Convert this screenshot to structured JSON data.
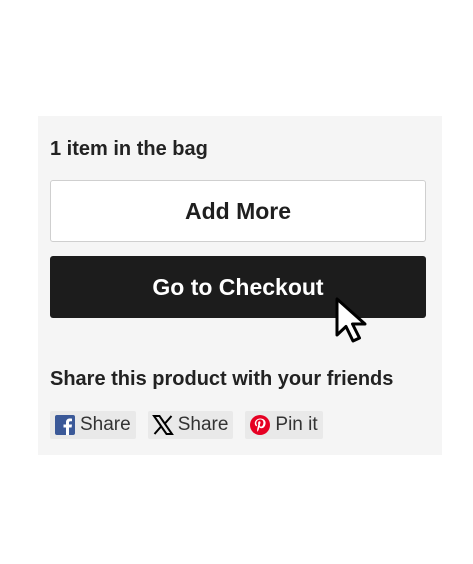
{
  "cart": {
    "item_count_text": "1 item in the bag",
    "add_more_label": "Add More",
    "checkout_label": "Go to Checkout"
  },
  "share": {
    "title": "Share this product with your friends",
    "buttons": [
      {
        "icon": "facebook-icon",
        "label": "Share",
        "color": "#3b5998"
      },
      {
        "icon": "x-icon",
        "label": "Share",
        "color": "#000000"
      },
      {
        "icon": "pinterest-icon",
        "label": "Pin it",
        "color": "#e60023"
      }
    ]
  },
  "colors": {
    "card_bg": "#f5f5f5",
    "checkout_bg": "#1c1c1c",
    "text": "#222222"
  }
}
